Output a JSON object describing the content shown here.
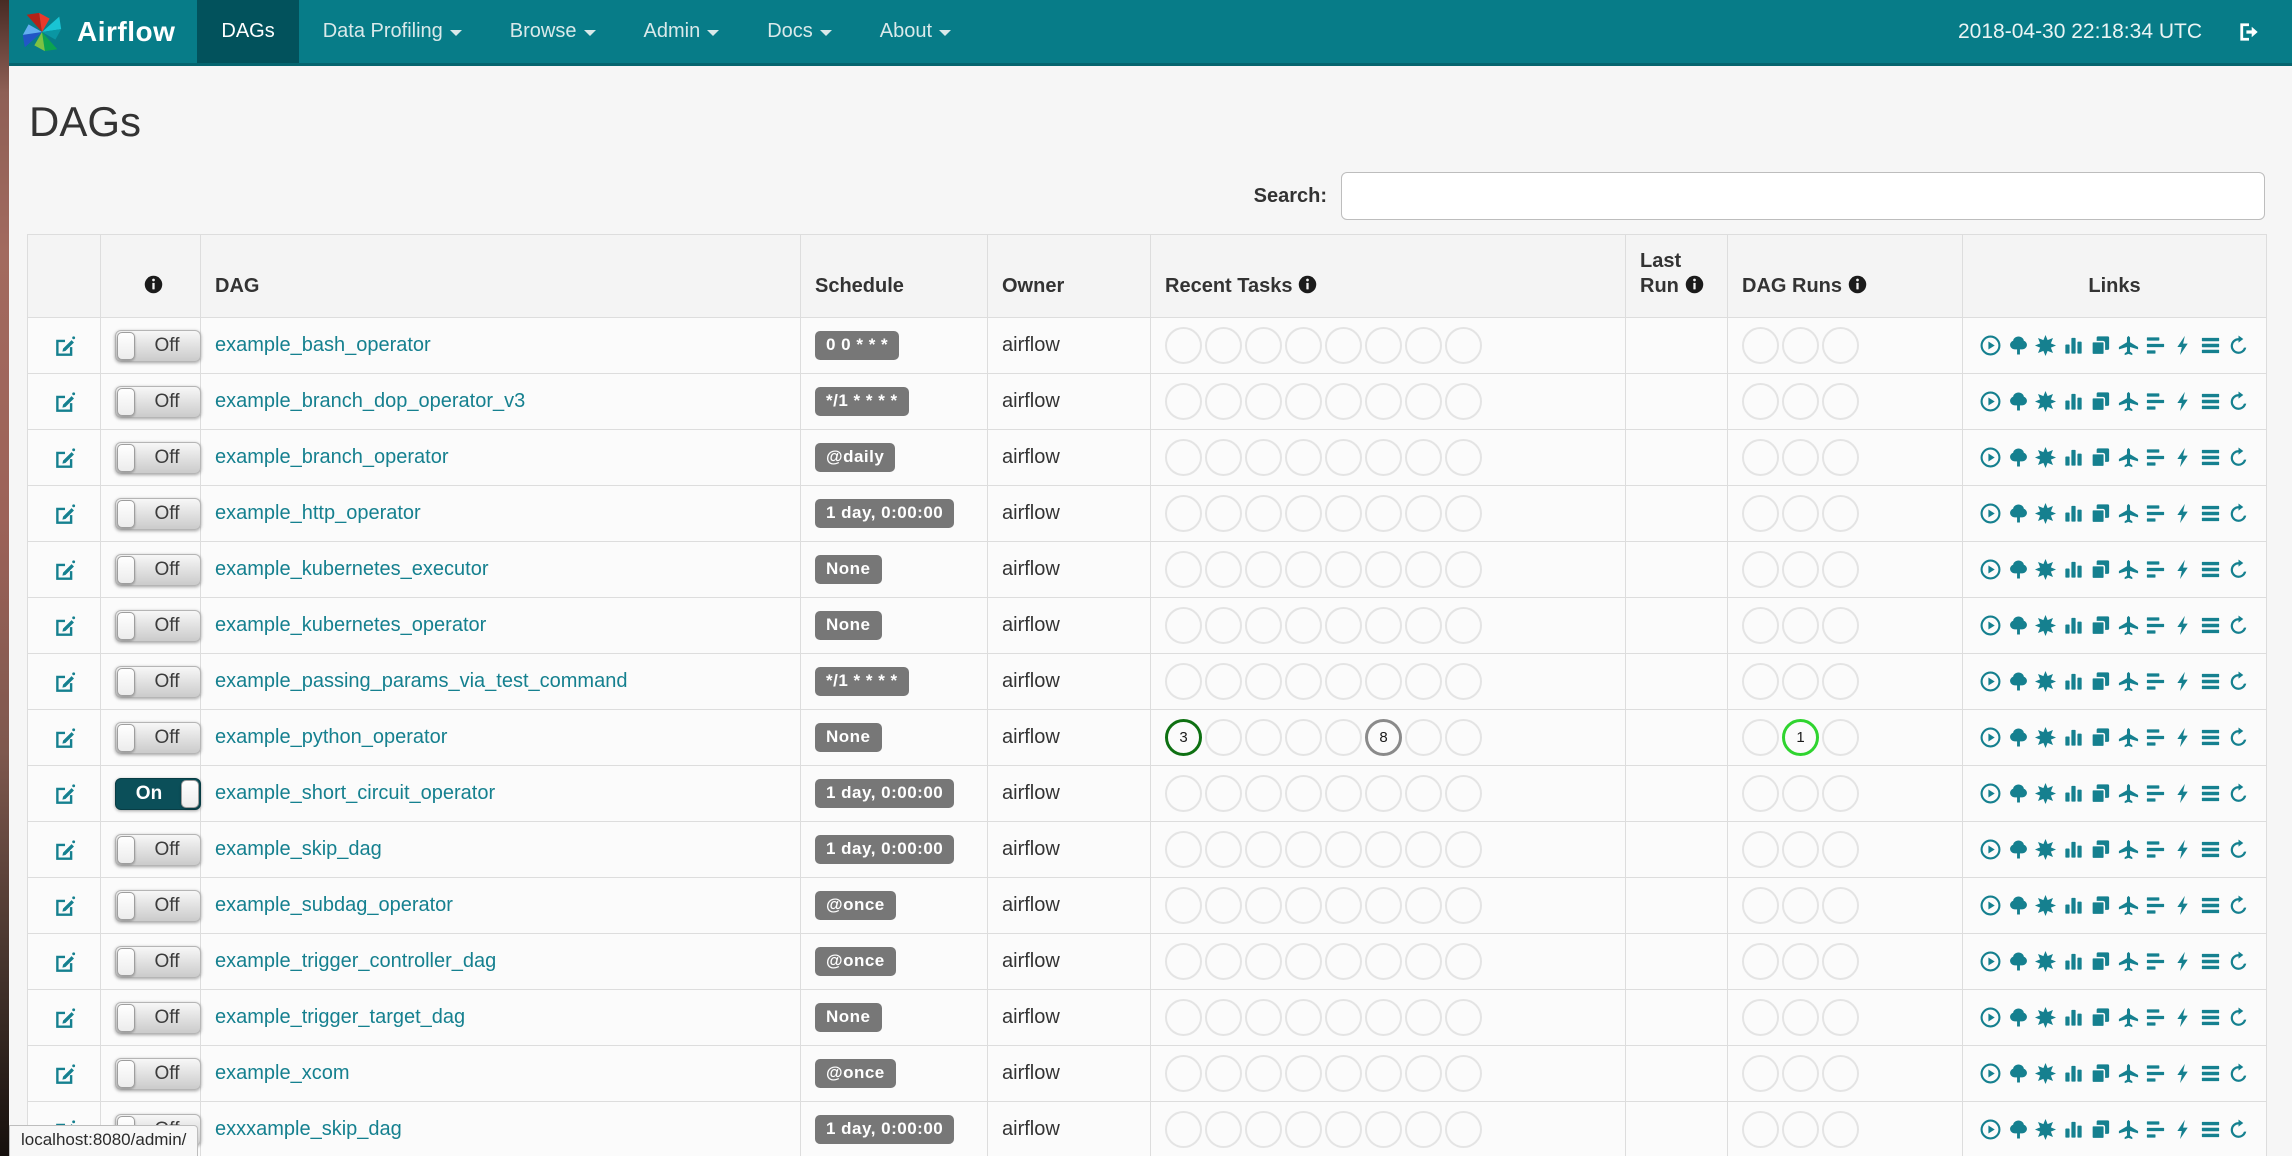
{
  "navbar": {
    "brand": "Airflow",
    "items": [
      {
        "label": "DAGs",
        "active": true,
        "caret": false
      },
      {
        "label": "Data Profiling",
        "active": false,
        "caret": true
      },
      {
        "label": "Browse",
        "active": false,
        "caret": true
      },
      {
        "label": "Admin",
        "active": false,
        "caret": true
      },
      {
        "label": "Docs",
        "active": false,
        "caret": true
      },
      {
        "label": "About",
        "active": false,
        "caret": true
      }
    ],
    "clock": "2018-04-30 22:18:34 UTC"
  },
  "page": {
    "title": "DAGs",
    "search_label": "Search:",
    "search_value": "",
    "status_bar": "localhost:8080/admin/"
  },
  "colors": {
    "navbar": "#077c88",
    "accent": "#15808f",
    "success": "#0e7012",
    "running": "#2fd42f",
    "queued": "#8a8a8a"
  },
  "table": {
    "headers": {
      "info": "",
      "dag": "DAG",
      "schedule": "Schedule",
      "owner": "Owner",
      "recent_tasks": "Recent Tasks",
      "last_run_line1": "Last",
      "last_run_line2": "Run",
      "dag_runs": "DAG Runs",
      "links": "Links"
    },
    "task_circle_count": 8,
    "dag_run_circle_count": 3,
    "link_icons": [
      "play-circle",
      "tree",
      "graph-burst",
      "bar-chart",
      "copy-docs",
      "plane",
      "gantt-bars",
      "bolt",
      "align-justify",
      "refresh"
    ],
    "rows": [
      {
        "name": "example_bash_operator",
        "schedule": "0 0 * * *",
        "owner": "airflow",
        "toggle": "Off",
        "last_run": "",
        "tasks": [],
        "runs": []
      },
      {
        "name": "example_branch_dop_operator_v3",
        "schedule": "*/1 * * * *",
        "owner": "airflow",
        "toggle": "Off",
        "last_run": "",
        "tasks": [],
        "runs": []
      },
      {
        "name": "example_branch_operator",
        "schedule": "@daily",
        "owner": "airflow",
        "toggle": "Off",
        "last_run": "",
        "tasks": [],
        "runs": []
      },
      {
        "name": "example_http_operator",
        "schedule": "1 day, 0:00:00",
        "owner": "airflow",
        "toggle": "Off",
        "last_run": "",
        "tasks": [],
        "runs": []
      },
      {
        "name": "example_kubernetes_executor",
        "schedule": "None",
        "owner": "airflow",
        "toggle": "Off",
        "last_run": "",
        "tasks": [],
        "runs": []
      },
      {
        "name": "example_kubernetes_operator",
        "schedule": "None",
        "owner": "airflow",
        "toggle": "Off",
        "last_run": "",
        "tasks": [],
        "runs": []
      },
      {
        "name": "example_passing_params_via_test_command",
        "schedule": "*/1 * * * *",
        "owner": "airflow",
        "toggle": "Off",
        "last_run": "",
        "tasks": [],
        "runs": []
      },
      {
        "name": "example_python_operator",
        "schedule": "None",
        "owner": "airflow",
        "toggle": "Off",
        "last_run": "",
        "tasks": [
          {
            "slot": 0,
            "count": "3",
            "state": "success"
          },
          {
            "slot": 5,
            "count": "8",
            "state": "gray"
          }
        ],
        "runs": [
          {
            "slot": 1,
            "count": "1",
            "state": "running"
          }
        ]
      },
      {
        "name": "example_short_circuit_operator",
        "schedule": "1 day, 0:00:00",
        "owner": "airflow",
        "toggle": "On",
        "last_run": "",
        "tasks": [],
        "runs": []
      },
      {
        "name": "example_skip_dag",
        "schedule": "1 day, 0:00:00",
        "owner": "airflow",
        "toggle": "Off",
        "last_run": "",
        "tasks": [],
        "runs": []
      },
      {
        "name": "example_subdag_operator",
        "schedule": "@once",
        "owner": "airflow",
        "toggle": "Off",
        "last_run": "",
        "tasks": [],
        "runs": []
      },
      {
        "name": "example_trigger_controller_dag",
        "schedule": "@once",
        "owner": "airflow",
        "toggle": "Off",
        "last_run": "",
        "tasks": [],
        "runs": []
      },
      {
        "name": "example_trigger_target_dag",
        "schedule": "None",
        "owner": "airflow",
        "toggle": "Off",
        "last_run": "",
        "tasks": [],
        "runs": []
      },
      {
        "name": "example_xcom",
        "schedule": "@once",
        "owner": "airflow",
        "toggle": "Off",
        "last_run": "",
        "tasks": [],
        "runs": []
      },
      {
        "name": "exxxample_skip_dag",
        "schedule": "1 day, 0:00:00",
        "owner": "airflow",
        "toggle": "Off",
        "last_run": "",
        "tasks": [],
        "runs": []
      }
    ]
  }
}
